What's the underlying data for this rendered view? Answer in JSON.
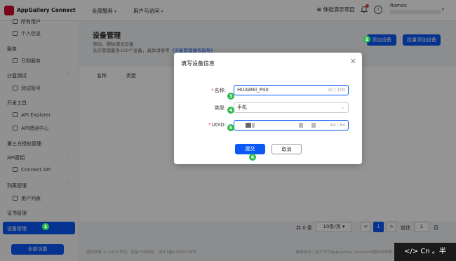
{
  "header": {
    "app_name": "AppGallery Connect",
    "nav": [
      "全部服务",
      "用户与访问"
    ],
    "experience_project": "体验演示项目",
    "username": "Ramos"
  },
  "sidebar": {
    "partial_top_item": "所有用户",
    "item_personal": "个人信息",
    "group_service": "服务",
    "item_service": "已购服务",
    "group_sandbox": "沙盒测试",
    "item_testaccount": "测试账号",
    "group_devtools": "开发工具",
    "item_apiexplorer": "API Explorer",
    "item_apierror": "API错误中心",
    "group_thirdparty": "第三方授权管理",
    "group_apikey": "API密钥",
    "item_connectapi": "Connect API",
    "group_list": "列表管理",
    "item_userlist": "用户列表",
    "group_cert": "证书管理",
    "active_item": "设备管理",
    "all_features": "全部功能"
  },
  "main": {
    "title": "设备管理",
    "desc1": "添加、删除调试设备",
    "desc2": "允许管理最多100个设备，具体请参考",
    "desc_link": "《设备管理操作指导》",
    "add_device": "添加设备",
    "batch_add": "批量添加设备",
    "col_name": "名称",
    "col_type": "类型"
  },
  "pagination": {
    "total": "共 0 条",
    "per_page": "10条/页",
    "prev": "<",
    "current": "1",
    "next": ">",
    "goto_label": "前往",
    "goto_value": "1",
    "page_suffix": "页"
  },
  "footer": {
    "copyright": "版权所有 © 2019 华为。保留一切权利。 苏ICP备17040376号",
    "links": "服务协议 | 关于华为AppGallery Connect与隐私的声明 | 隐私政策 | 联系我们 | cookies"
  },
  "modal": {
    "title": "填写设备信息",
    "close": "✕",
    "label_name": "名称",
    "value_name": "HUAWEI_P40",
    "count_name": "10 / 100",
    "label_type": "类型",
    "value_type": "手机",
    "label_udid": "UDID",
    "count_udid": "64 / 64",
    "submit": "提交",
    "cancel": "取消"
  },
  "steps": [
    "1",
    "2",
    "3",
    "4",
    "5",
    "6"
  ],
  "watermark": "</> Cn 。半 ",
  "colors": {
    "primary": "#0a59f7",
    "step_badge": "#2dbb4d",
    "required": "#e63c3c",
    "brand": "#cf0a2c"
  },
  "icons": [
    "huawei-logo-icon",
    "bell-icon",
    "help-icon",
    "close-icon",
    "chevron-down-icon",
    "menu-item-icon"
  ]
}
